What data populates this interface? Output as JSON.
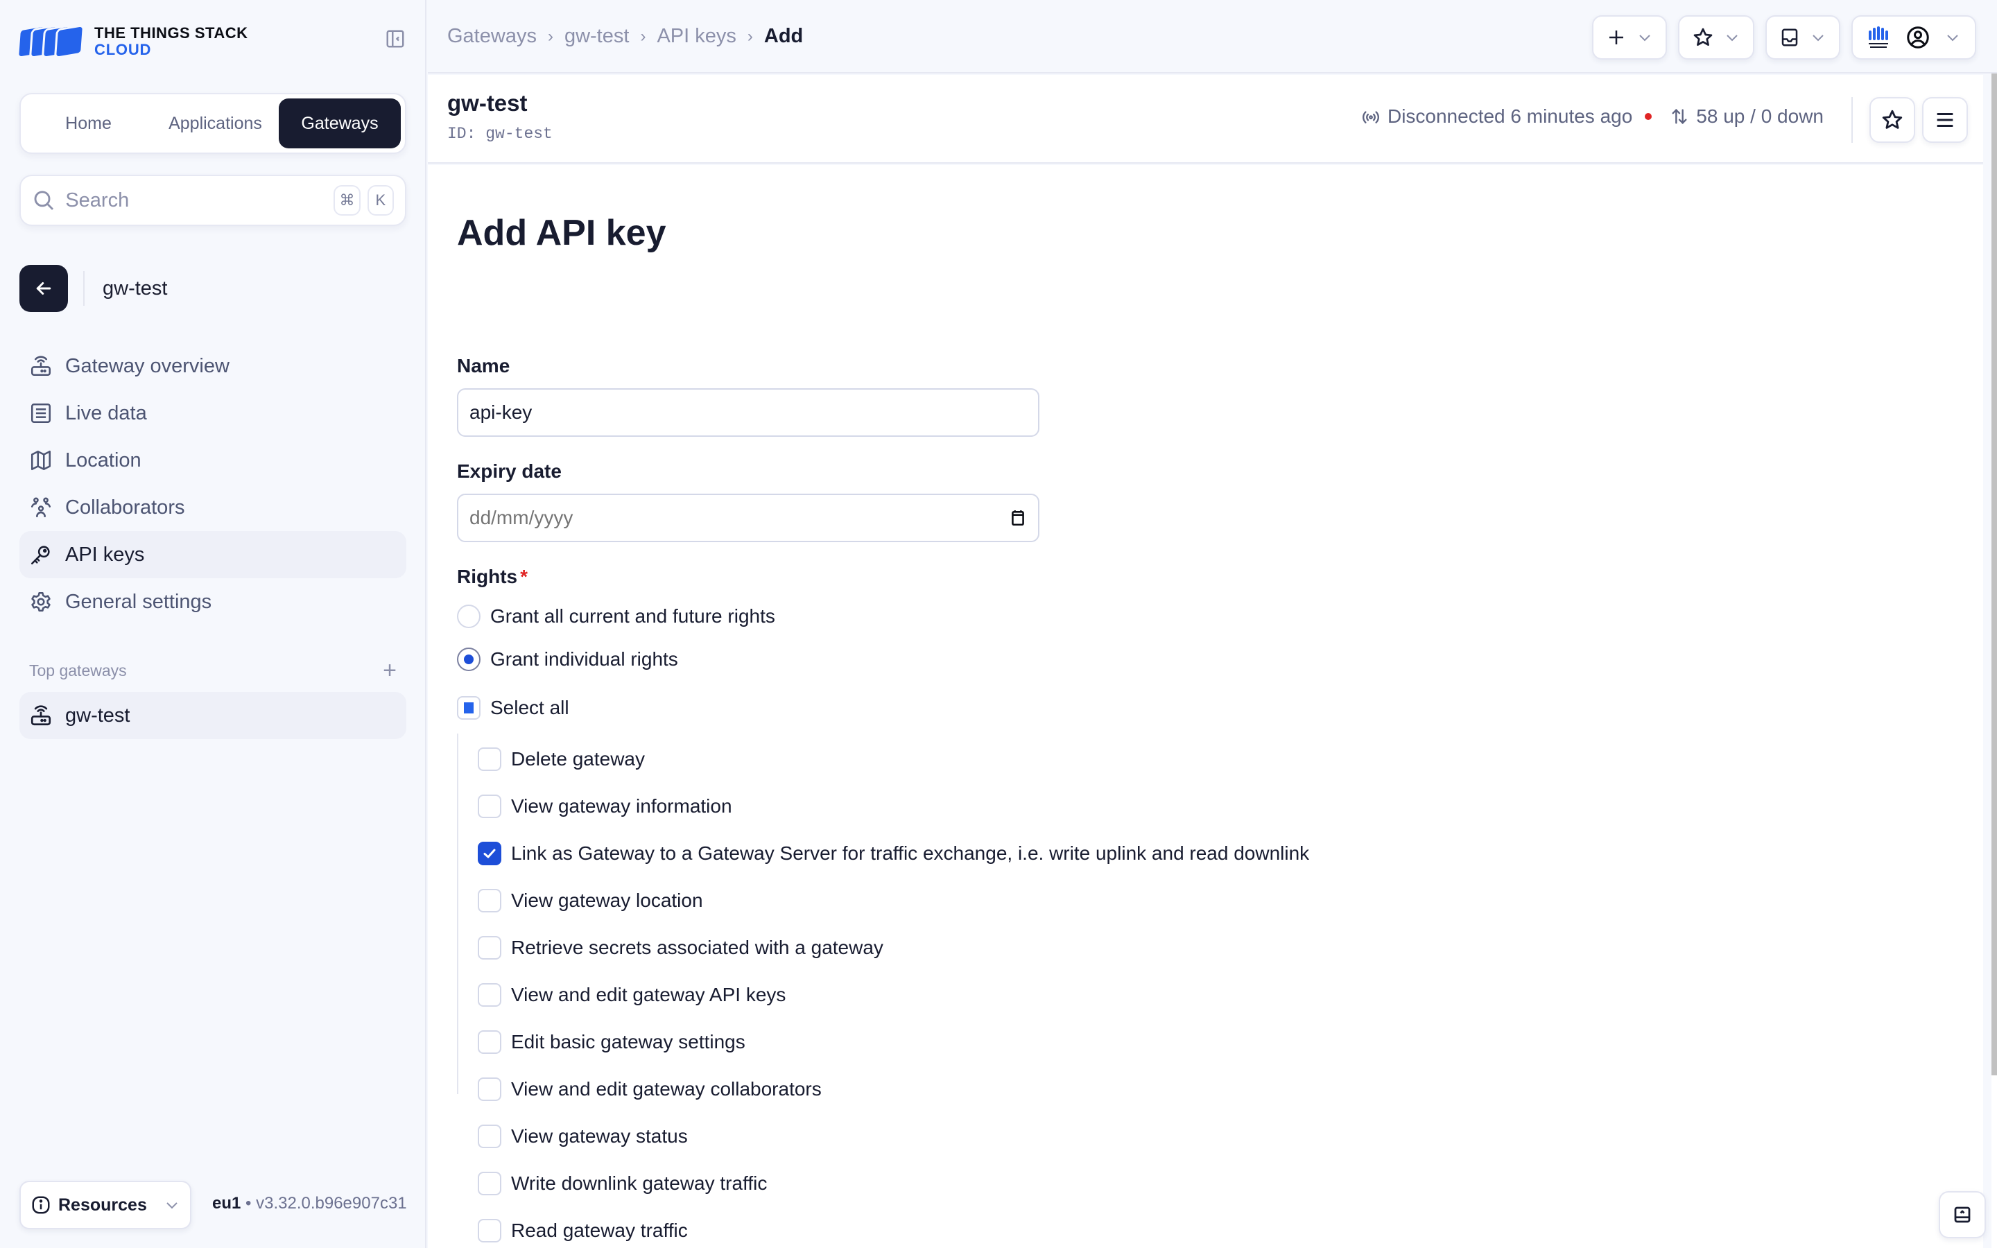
{
  "app": {
    "logo_line1": "THE THINGS STACK",
    "logo_line2": "CLOUD",
    "brand_color": "#2563eb"
  },
  "sidebar": {
    "tabs": [
      {
        "label": "Home",
        "active": false
      },
      {
        "label": "Applications",
        "active": false
      },
      {
        "label": "Gateways",
        "active": true
      }
    ],
    "search": {
      "placeholder": "Search",
      "shortcut_mod": "⌘",
      "shortcut_key": "K"
    },
    "context_title": "gw-test",
    "nav": [
      {
        "label": "Gateway overview",
        "icon": "gateway-icon",
        "active": false
      },
      {
        "label": "Live data",
        "icon": "list-icon",
        "active": false
      },
      {
        "label": "Location",
        "icon": "map-icon",
        "active": false
      },
      {
        "label": "Collaborators",
        "icon": "users-icon",
        "active": false
      },
      {
        "label": "API keys",
        "icon": "key-icon",
        "active": true
      },
      {
        "label": "General settings",
        "icon": "gear-icon",
        "active": false
      }
    ],
    "top_section_title": "Top gateways",
    "top_items": [
      {
        "label": "gw-test",
        "icon": "gateway-icon"
      }
    ],
    "resources_label": "Resources",
    "cluster": "eu1",
    "version": "v3.32.0.b96e907c31"
  },
  "topbar": {
    "breadcrumb": [
      "Gateways",
      "gw-test",
      "API keys",
      "Add"
    ],
    "actions": [
      "add-menu",
      "bookmarks-menu",
      "notifications-menu",
      "account-menu"
    ]
  },
  "gateway": {
    "name": "gw-test",
    "id_label": "ID:",
    "id": "gw-test",
    "status_text": "Disconnected 6 minutes ago",
    "status_color": "#e02424",
    "traffic": "58 up / 0 down"
  },
  "form": {
    "title": "Add API key",
    "name_label": "Name",
    "name_value": "api-key",
    "expiry_label": "Expiry date",
    "expiry_placeholder": "dd/mm/yyyy",
    "rights_label": "Rights",
    "rights_required": "*",
    "rights_options": [
      {
        "label": "Grant all current and future rights",
        "selected": false
      },
      {
        "label": "Grant individual rights",
        "selected": true
      }
    ],
    "select_all_label": "Select all",
    "select_all_state": "indeterminate",
    "rights": [
      {
        "label": "Delete gateway",
        "checked": false
      },
      {
        "label": "View gateway information",
        "checked": false
      },
      {
        "label": "Link as Gateway to a Gateway Server for traffic exchange, i.e. write uplink and read downlink",
        "checked": true
      },
      {
        "label": "View gateway location",
        "checked": false
      },
      {
        "label": "Retrieve secrets associated with a gateway",
        "checked": false
      },
      {
        "label": "View and edit gateway API keys",
        "checked": false
      },
      {
        "label": "Edit basic gateway settings",
        "checked": false
      },
      {
        "label": "View and edit gateway collaborators",
        "checked": false
      },
      {
        "label": "View gateway status",
        "checked": false
      },
      {
        "label": "Write downlink gateway traffic",
        "checked": false
      },
      {
        "label": "Read gateway traffic",
        "checked": false
      }
    ]
  }
}
